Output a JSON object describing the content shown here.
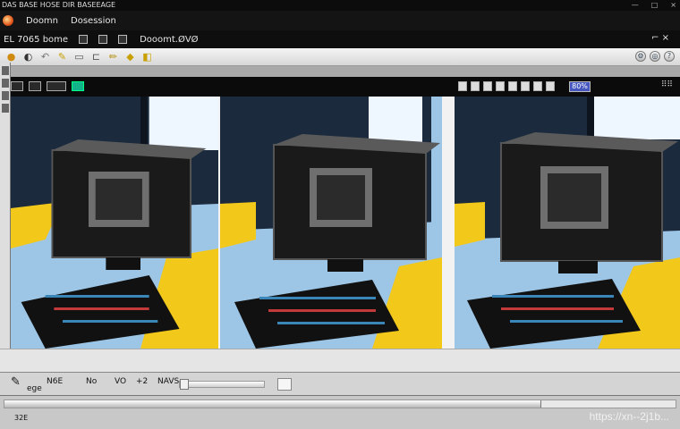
{
  "window": {
    "title": "DAS BASE HOSE DIR BASEEAGE",
    "controls": [
      "—",
      "□",
      "×"
    ]
  },
  "app_header": {
    "menu_items": [
      "Doomn",
      "Dosession"
    ]
  },
  "doc_toolbar": {
    "label": "EL 7065 bome",
    "title": "Dooomt.ØVØ",
    "right_text": "⌐ ×"
  },
  "view_toolbar": {
    "zoom_label": "80%",
    "more": "⠿⠿"
  },
  "images": [
    {
      "alt": "computer monitor with keyboard on desk"
    },
    {
      "alt": "computer monitor with keyboard on desk"
    },
    {
      "alt": "computer monitor with keyboard on desk"
    }
  ],
  "status": {
    "item1": "N6E",
    "item2": "ege",
    "item3": "No",
    "item4": "VO",
    "item5": "+2",
    "item6": "NAVS"
  },
  "footer": {
    "label": "32E",
    "watermark": "https://xn--2j1b..."
  },
  "colors": {
    "accent_yellow": "#f2c81a",
    "desk_blue": "#9dc6e6",
    "wall_dark": "#1b2a3d",
    "zoom_badge": "#4658c0",
    "view_button_green": "#12b38a"
  },
  "scroll_position": 0.8
}
